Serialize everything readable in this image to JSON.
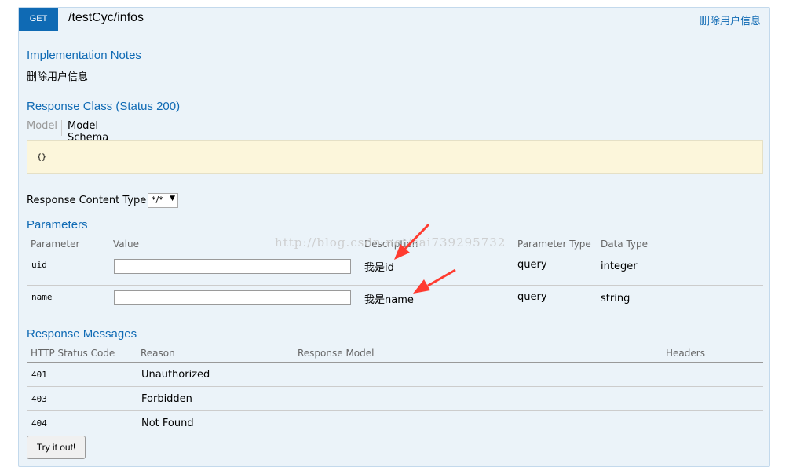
{
  "operation": {
    "method": "GET",
    "path": "/testCyc/infos",
    "summary": "删除用户信息"
  },
  "implementation_notes": {
    "title": "Implementation Notes",
    "text": "删除用户信息"
  },
  "response_class": {
    "title": "Response Class (Status 200)",
    "tabs": [
      "Model",
      "Model Schema"
    ],
    "schema": "{}"
  },
  "response_content_type": {
    "label": "Response Content Type",
    "value": "*/*"
  },
  "parameters": {
    "title": "Parameters",
    "columns": [
      "Parameter",
      "Value",
      "Description",
      "Parameter Type",
      "Data Type"
    ],
    "rows": [
      {
        "name": "uid",
        "value": "",
        "description": "我是id",
        "param_type": "query",
        "data_type": "integer"
      },
      {
        "name": "name",
        "value": "",
        "description": "我是name",
        "param_type": "query",
        "data_type": "string"
      }
    ]
  },
  "response_messages": {
    "title": "Response Messages",
    "columns": [
      "HTTP Status Code",
      "Reason",
      "Response Model",
      "Headers"
    ],
    "rows": [
      {
        "code": "401",
        "reason": "Unauthorized"
      },
      {
        "code": "403",
        "reason": "Forbidden"
      },
      {
        "code": "404",
        "reason": "Not Found"
      }
    ]
  },
  "try_button": "Try it out!",
  "watermark": "http://blog.csdn.net/sai739295732",
  "colors": {
    "method_get": "#0f6ab4",
    "panel_bg": "#ebf3f9",
    "heading": "#0f6ab4",
    "snippet_bg": "#fcf6db",
    "annotation_arrow": "#ff3b30"
  }
}
